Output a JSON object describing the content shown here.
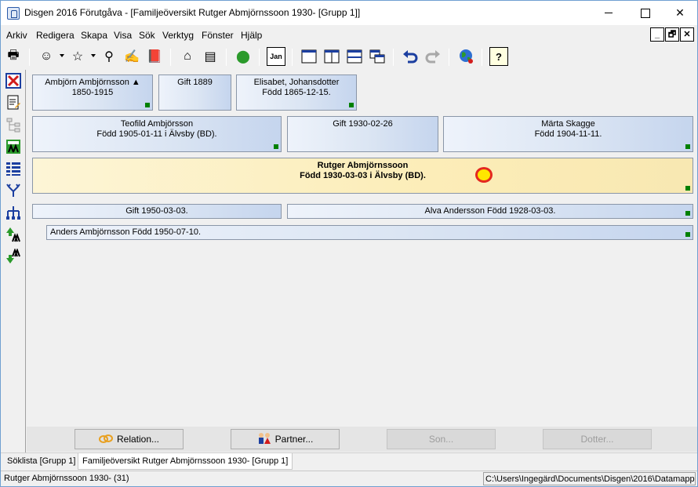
{
  "window": {
    "title": "Disgen 2016 Förutgåva - [Familjeöversikt Rutger Abmjörnssoon 1930- [Grupp 1]]"
  },
  "menu": [
    "Arkiv",
    "Redigera",
    "Skapa",
    "Visa",
    "Sök",
    "Verktyg",
    "Fönster",
    "Hjälp"
  ],
  "mdi": {
    "minimize": "_",
    "restore": "🗗",
    "close": "✕"
  },
  "toolbar": {
    "print": "🖶",
    "person": "☺",
    "star": "☆",
    "binoculars": "⚲",
    "edit": "✍",
    "book": "📕",
    "home": "⌂",
    "books": "▤",
    "map": "⬤",
    "calendar": "Jan",
    "help": "?"
  },
  "cards": {
    "grandfather": {
      "line1": "Ambjörn Ambjörnsson ▲",
      "line2": "1850-1915"
    },
    "grandparents_marriage": {
      "line1": "Gift 1889"
    },
    "grandmother": {
      "line1": "Elisabet, Johansdotter",
      "line2": "Född 1865-12-15."
    },
    "father": {
      "line1": "Teofild Ambjörsson",
      "line2": "Född 1905-01-11 i Älvsby (BD)."
    },
    "parents_marriage": {
      "line1": "Gift 1930-02-26"
    },
    "mother": {
      "line1": "Märta Skagge",
      "line2": "Född 1904-11-11."
    },
    "main_person": {
      "line1": "Rutger Abmjörnssoon",
      "line2": "Född 1930-03-03 i Älvsby (BD)."
    },
    "marriage": {
      "line1": "Gift 1950-03-03."
    },
    "spouse": {
      "line1": "Alva Andersson Född 1928-03-03."
    },
    "child": {
      "line1": "Anders Ambjörnsson Född 1950-07-10."
    }
  },
  "buttons": {
    "relation": "Relation...",
    "partner": "Partner...",
    "son": "Son...",
    "dotter": "Dotter..."
  },
  "tabs": [
    "Söklista [Grupp 1]",
    "Familjeöversikt Rutger Abmjörnssoon 1930- [Grupp 1]"
  ],
  "status": {
    "left": "Rutger Abmjörnssoon 1930- (31)",
    "right": "C:\\Users\\Ingegärd\\Documents\\Disgen\\2016\\Datamapp"
  }
}
